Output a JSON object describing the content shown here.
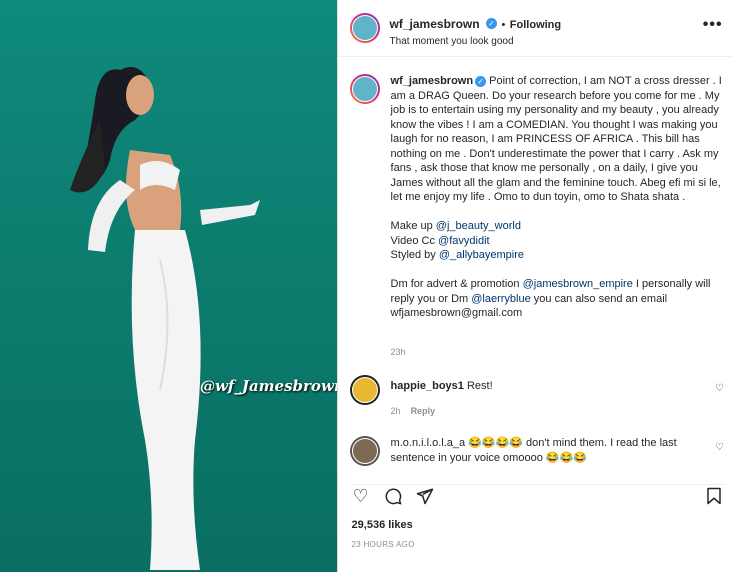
{
  "media": {
    "watermark": "@wf_Jamesbrown"
  },
  "header": {
    "username": "wf_jamesbrown",
    "follow_status": "Following",
    "subtitle": "That moment you look good",
    "separator": "•",
    "more_icon": "more-horizontal-icon"
  },
  "caption": {
    "username": "wf_jamesbrown",
    "text1": "Point of correction, I am NOT a cross dresser . I am a DRAG Queen. Do your research before you come for me . My job is to entertain using my personality and my beauty , you already know the vibes ! I am a COMEDIAN. You thought I was making you laugh for no reason, I am PRINCESS OF AFRICA . This bill has nothing on me . Don't underestimate the power that I carry . Ask my fans , ask those that know me personally , on a daily, I give you James without all the glam and the feminine touch. Abeg efi mi si le, let me enjoy my life . Omo to dun toyin, omo to Shata shata .",
    "makeup_prefix": "Make up ",
    "makeup_link": "@j_beauty_world",
    "video_prefix": "Video Cc ",
    "video_link": "@favydidit",
    "styled_prefix": "Styled by ",
    "styled_link": "@_allybayempire",
    "dm_prefix": "Dm for advert & promotion ",
    "dm_link1": "@jamesbrown_empire",
    "dm_middle": " I personally will reply you or Dm ",
    "dm_link2": "@laerryblue",
    "dm_suffix": " you can also send an email wfjamesbrown@gmail.com",
    "time": "23h"
  },
  "comments": [
    {
      "username": "happie_boys1",
      "text": " Rest!",
      "time": "2h",
      "reply": "Reply"
    },
    {
      "username": "m.o.n.i.l.o.l.a_a",
      "text": " 😂😂😂😂 don't mind them. I read the last sentence in your voice omoooo 😂😂😂"
    }
  ],
  "actions": {
    "like_icon": "heart-icon",
    "comment_icon": "comment-icon",
    "share_icon": "send-icon",
    "save_icon": "bookmark-icon"
  },
  "likes": "29,536 likes",
  "timestamp": "23 HOURS AGO"
}
